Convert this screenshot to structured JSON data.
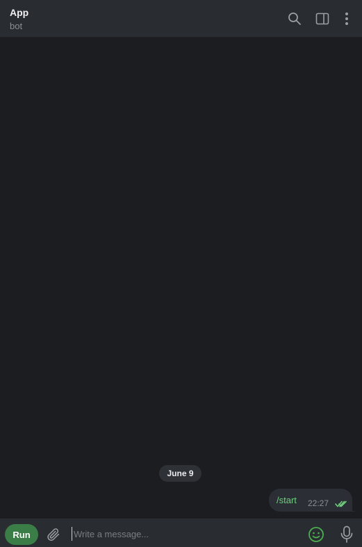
{
  "header": {
    "title": "App",
    "subtitle": "bot",
    "icons": [
      "search-icon",
      "sidebar-toggle-icon",
      "more-vertical-icon"
    ]
  },
  "chat": {
    "date_separator": "June 9",
    "messages": [
      {
        "text": "/start",
        "time": "22:27",
        "status": "read",
        "outgoing": true
      }
    ]
  },
  "composer": {
    "run_label": "Run",
    "placeholder": "Write a message...",
    "value": "",
    "icons": [
      "paperclip-icon",
      "emoji-icon",
      "microphone-icon"
    ]
  },
  "colors": {
    "background": "#1b1d21",
    "header": "#292c31",
    "bubble": "#2b2f35",
    "accent": "#3b7d46",
    "message_text": "#6fcf7d"
  }
}
